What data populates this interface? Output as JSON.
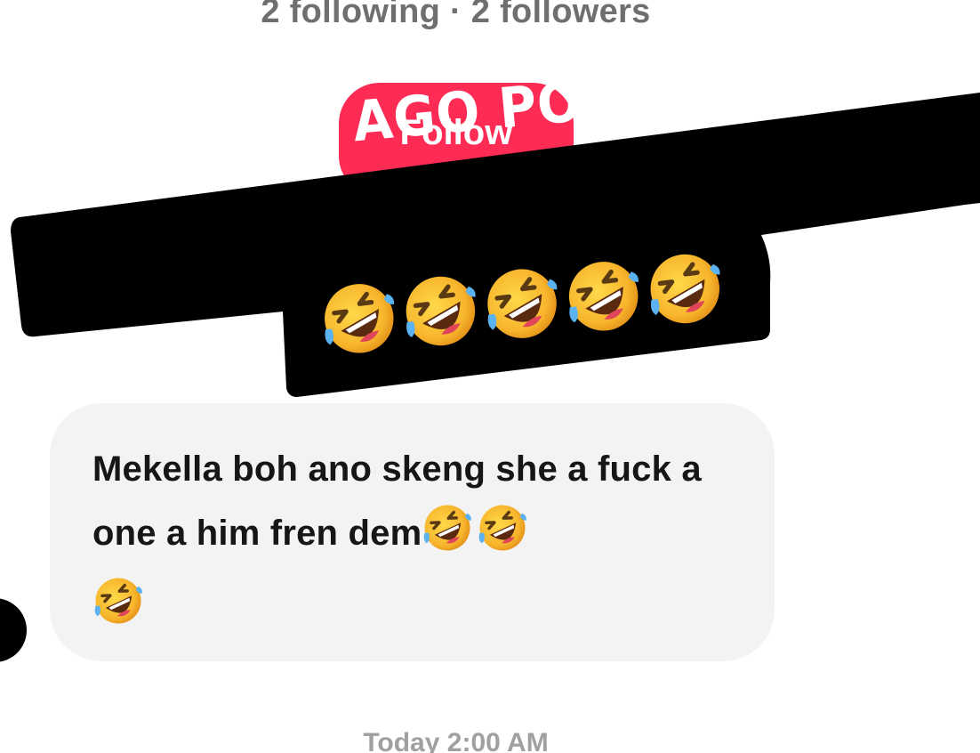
{
  "profile": {
    "follow_stats": "2 following · 2 followers",
    "follow_button_label": "Follow"
  },
  "overlay": {
    "headline": "NOW MIH AGO POST THE PROOF",
    "emojis": [
      "rolling-on-floor-laughing",
      "rolling-on-floor-laughing",
      "rolling-on-floor-laughing",
      "rolling-on-floor-laughing",
      "rolling-on-floor-laughing"
    ]
  },
  "message": {
    "text": "Mekella boh ano skeng she a fuck a one a him fren dem",
    "trailing_emojis": [
      "rolling-on-floor-laughing",
      "rolling-on-floor-laughing",
      "rolling-on-floor-laughing"
    ]
  },
  "timestamp": "Today 2:00 AM",
  "colors": {
    "follow_button": "#fe2c55",
    "overlay_bg": "#000000",
    "bubble_bg": "#f3f3f3",
    "stats_text": "#6f6f6f",
    "timestamp_text": "#a0a0a0"
  }
}
